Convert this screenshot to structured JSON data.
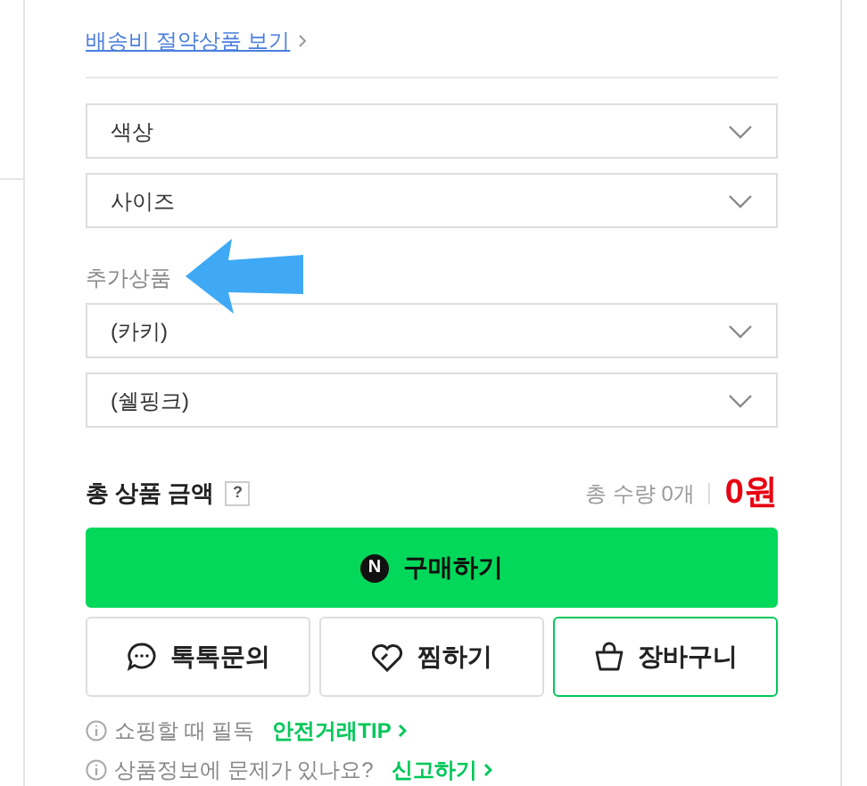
{
  "delivery": {
    "link": "배송비 절약상품 보기"
  },
  "selects": [
    {
      "label": "색상"
    },
    {
      "label": "사이즈"
    }
  ],
  "addon_label": "추가상품",
  "addon_selects": [
    {
      "label": "(카키)"
    },
    {
      "label": "(쉘핑크)"
    }
  ],
  "total": {
    "label": "총 상품 금액",
    "help": "?",
    "quantity": "총 수량 0개",
    "price": "0원"
  },
  "buy_button": {
    "badge": "N",
    "label": "구매하기"
  },
  "actions": [
    {
      "kind": "talk",
      "label": "톡톡문의",
      "highlighted": false
    },
    {
      "kind": "wish",
      "label": "찜하기",
      "highlighted": false
    },
    {
      "kind": "cart",
      "label": "장바구니",
      "highlighted": true
    }
  ],
  "notices": [
    {
      "text": "쇼핑할 때 필독",
      "link": "안전거래TIP"
    },
    {
      "text": "상품정보에 문제가 있나요?",
      "link": "신고하기"
    }
  ]
}
